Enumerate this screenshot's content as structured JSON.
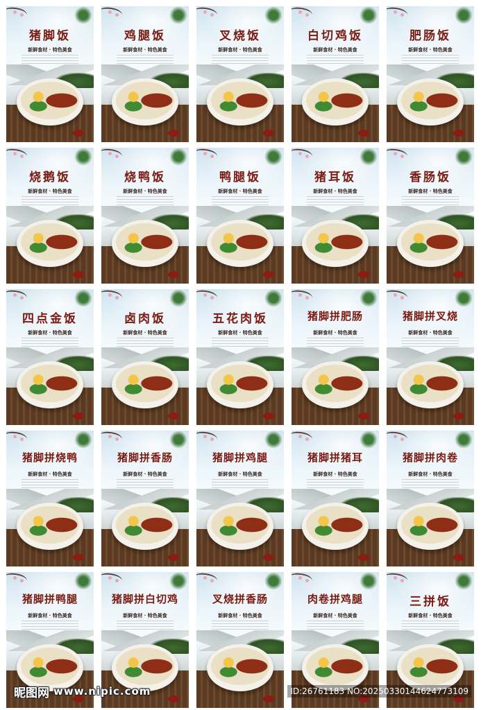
{
  "posters": [
    {
      "title": "猪脚饭"
    },
    {
      "title": "鸡腿饭"
    },
    {
      "title": "叉烧饭"
    },
    {
      "title": "白切鸡饭"
    },
    {
      "title": "肥肠饭"
    },
    {
      "title": "烧鹅饭"
    },
    {
      "title": "烧鸭饭"
    },
    {
      "title": "鸭腿饭"
    },
    {
      "title": "猪耳饭"
    },
    {
      "title": "香肠饭"
    },
    {
      "title": "四点金饭"
    },
    {
      "title": "卤肉饭"
    },
    {
      "title": "五花肉饭"
    },
    {
      "title": "猪脚拼肥肠"
    },
    {
      "title": "猪脚拼叉烧"
    },
    {
      "title": "猪脚拼烧鸭"
    },
    {
      "title": "猪脚拼香肠"
    },
    {
      "title": "猪脚拼鸡腿"
    },
    {
      "title": "猪脚拼猪耳"
    },
    {
      "title": "猪脚拼肉卷"
    },
    {
      "title": "猪脚拼鸭腿"
    },
    {
      "title": "猪脚拼白切鸡"
    },
    {
      "title": "叉烧拼香肠"
    },
    {
      "title": "肉卷拼鸡腿"
    },
    {
      "title": "三拼饭"
    }
  ],
  "tagline": "新鲜食材 · 特色美食",
  "watermark": {
    "logo": "昵图网",
    "url": "www.nipic.com",
    "id": "ID:26761183 NO:20250330144624773109"
  },
  "colors": {
    "title": "#7a1b12",
    "wood": "#5a3a22"
  }
}
